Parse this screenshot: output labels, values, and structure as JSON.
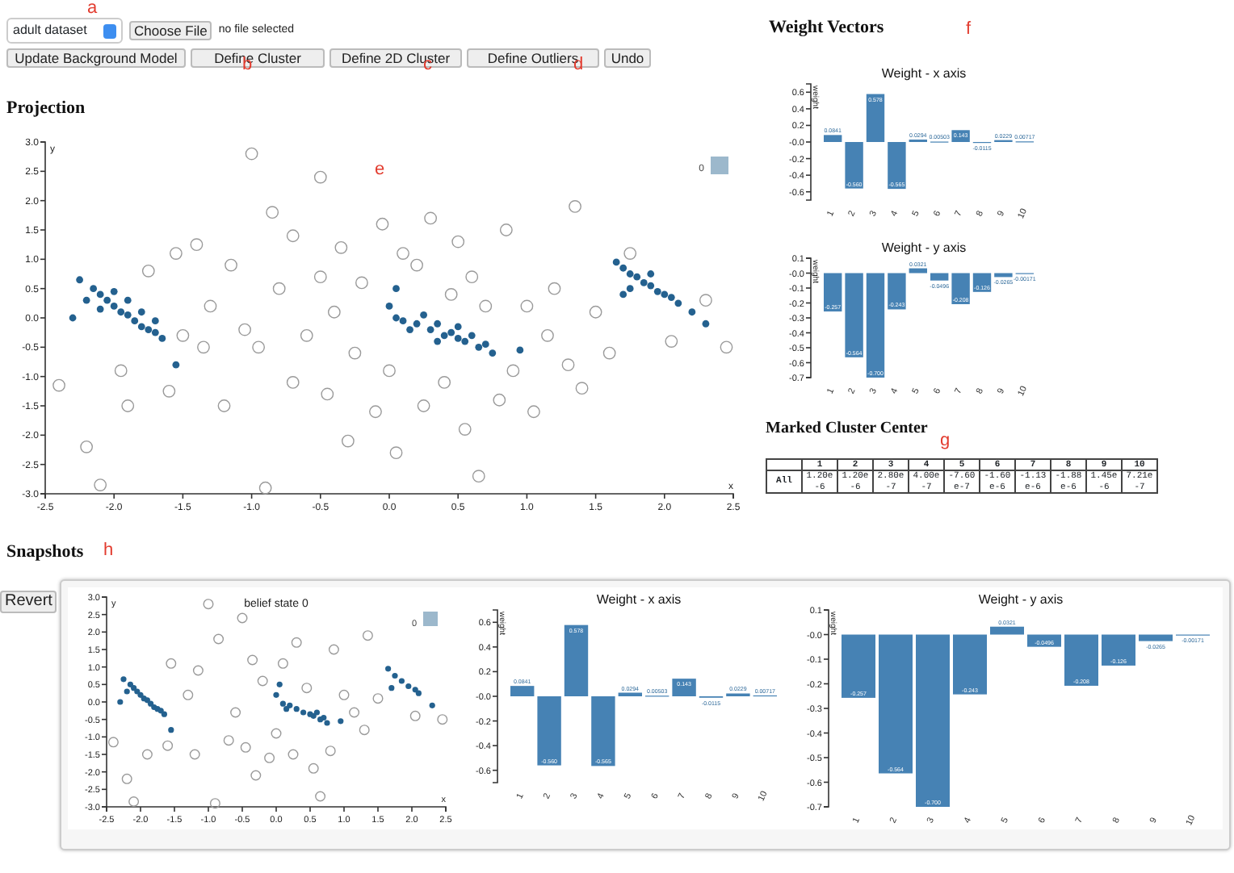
{
  "annotations": [
    "a",
    "b",
    "c",
    "d",
    "e",
    "f",
    "g",
    "h"
  ],
  "toolbar": {
    "dataset_select": "adult dataset",
    "file_button": "Choose File",
    "file_status": "no file selected",
    "buttons": [
      "Update Background Model",
      "Define Cluster",
      "Define 2D Cluster",
      "Define Outliers",
      "Undo"
    ]
  },
  "projection": {
    "title": "Projection",
    "chart_data": {
      "type": "scatter",
      "xlabel": "x",
      "ylabel": "y",
      "xlim": [
        -2.5,
        2.5
      ],
      "ylim": [
        -3,
        3
      ],
      "xticks": [
        {
          "value": -2.5,
          "label": "-2.5"
        },
        {
          "value": -2,
          "label": "-2.0"
        },
        {
          "value": -1.5,
          "label": "-1.5"
        },
        {
          "value": -1,
          "label": "-1.0"
        },
        {
          "value": -0.5,
          "label": "-0.5"
        },
        {
          "value": 0,
          "label": "0.0"
        },
        {
          "value": 0.5,
          "label": "0.5"
        },
        {
          "value": 1,
          "label": "1.0"
        },
        {
          "value": 1.5,
          "label": "1.5"
        },
        {
          "value": 2,
          "label": "2.0"
        },
        {
          "value": 2.5,
          "label": "2.5"
        }
      ],
      "yticks": [
        {
          "value": -3,
          "label": "-3.0"
        },
        {
          "value": -2.5,
          "label": "-2.5"
        },
        {
          "value": -2,
          "label": "-2.0"
        },
        {
          "value": -1.5,
          "label": "-1.5"
        },
        {
          "value": -1,
          "label": "-1.0"
        },
        {
          "value": -0.5,
          "label": "-0.5"
        },
        {
          "value": 0,
          "label": "0.0"
        },
        {
          "value": 0.5,
          "label": "0.5"
        },
        {
          "value": 1,
          "label": "1.0"
        },
        {
          "value": 1.5,
          "label": "1.5"
        },
        {
          "value": 2,
          "label": "2.0"
        },
        {
          "value": 2.5,
          "label": "2.5"
        },
        {
          "value": 3,
          "label": "3.0"
        }
      ],
      "series": [
        {
          "name": "0",
          "color": "#24618f",
          "x": [
            -2.25,
            -2.15,
            -2.1,
            -2.05,
            -2,
            -1.95,
            -1.9,
            -1.85,
            -1.8,
            -1.75,
            -1.7,
            -1.65,
            -2.2,
            -2,
            -1.9,
            -1.8,
            -1.7,
            -1.55,
            -2.3,
            -2.1,
            0,
            0.05,
            0.1,
            0.2,
            0.3,
            0.35,
            0.4,
            0.45,
            0.5,
            0.55,
            0.6,
            0.65,
            0.7,
            0.25,
            0.15,
            0.5,
            0.75,
            0.95,
            0.05,
            0.35,
            1.65,
            1.7,
            1.75,
            1.8,
            1.85,
            1.9,
            1.95,
            2,
            2.05,
            2.1,
            1.75,
            1.9,
            2.2,
            2.3,
            1.7
          ],
          "values": [
            0.65,
            0.5,
            0.4,
            0.3,
            0.2,
            0.1,
            0.05,
            -0.05,
            -0.15,
            -0.2,
            -0.25,
            -0.35,
            0.3,
            0.45,
            0.3,
            0.1,
            -0.05,
            -0.8,
            0,
            0.15,
            0.2,
            0,
            -0.05,
            -0.1,
            -0.2,
            -0.1,
            -0.3,
            -0.25,
            -0.35,
            -0.4,
            -0.3,
            -0.5,
            -0.45,
            0.05,
            -0.2,
            -0.15,
            -0.6,
            -0.55,
            0.5,
            -0.4,
            0.95,
            0.85,
            0.75,
            0.7,
            0.6,
            0.55,
            0.45,
            0.4,
            0.35,
            0.25,
            0.5,
            0.75,
            0.1,
            -0.1,
            0.4
          ]
        },
        {
          "color": "#9a9a9a",
          "x": [
            -2.4,
            -2.2,
            -2.1,
            -1.9,
            -1.95,
            -1.6,
            -1.75,
            -1.55,
            -1.4,
            -1.3,
            -1.35,
            -1.2,
            -1.15,
            -1.05,
            -1,
            -0.9,
            -0.95,
            -0.85,
            -0.8,
            -0.7,
            -0.7,
            -0.6,
            -0.5,
            -0.5,
            -0.45,
            -0.4,
            -0.35,
            -0.3,
            -0.25,
            -0.2,
            -0.1,
            -0.05,
            0,
            0.05,
            0.1,
            0.2,
            0.25,
            0.3,
            0.4,
            0.45,
            0.5,
            0.55,
            0.6,
            0.65,
            0.7,
            0.8,
            0.85,
            0.9,
            1,
            1.05,
            1.15,
            1.2,
            1.3,
            1.35,
            1.4,
            1.5,
            1.6,
            1.75,
            2.05,
            2.3,
            2.45,
            -1.5
          ],
          "values": [
            -1.15,
            -2.2,
            -2.85,
            -1.5,
            -0.9,
            -1.25,
            0.8,
            1.1,
            1.25,
            0.2,
            -0.5,
            -1.5,
            0.9,
            -0.2,
            2.8,
            -2.9,
            -0.5,
            1.8,
            0.5,
            -1.1,
            1.4,
            -0.3,
            2.4,
            0.7,
            -1.3,
            0.1,
            1.2,
            -2.1,
            -0.6,
            0.6,
            -1.6,
            1.6,
            -0.9,
            -2.3,
            1.1,
            0.9,
            -1.5,
            1.7,
            -1.1,
            0.4,
            1.3,
            -1.9,
            0.7,
            -2.7,
            0.2,
            -1.4,
            1.5,
            -0.9,
            0.2,
            -1.6,
            -0.3,
            0.5,
            -0.8,
            1.9,
            -1.2,
            0.1,
            -0.6,
            1.1,
            -0.4,
            0.3,
            -0.5,
            -0.3
          ]
        }
      ]
    }
  },
  "weight_vectors": {
    "title": "Weight Vectors",
    "charts": [
      {
        "chart_data": {
          "type": "bar",
          "title": "Weight - x axis",
          "ylabel": "weight",
          "categories": [
            "1",
            "2",
            "3",
            "4",
            "5",
            "6",
            "7",
            "8",
            "9",
            "10"
          ],
          "values": [
            0.0841,
            -0.56,
            0.578,
            -0.565,
            0.0294,
            0.00503,
            0.143,
            -0.0115,
            0.0229,
            0.00717
          ],
          "ylim": [
            -0.7,
            0.7
          ],
          "yticks": [
            {
              "value": -0.6,
              "label": "-0.6"
            },
            {
              "value": -0.4,
              "label": "-0.4"
            },
            {
              "value": -0.2,
              "label": "-0.2"
            },
            {
              "value": 0,
              "label": "-0.0"
            },
            {
              "value": 0.2,
              "label": "0.2"
            },
            {
              "value": 0.4,
              "label": "0.4"
            },
            {
              "value": 0.6,
              "label": "0.6"
            }
          ],
          "value_labels": [
            "0.0841",
            "-0.560",
            "0.578",
            "-0.565",
            "0.0294",
            "0.00503",
            "0.143",
            "-0.0115",
            "0.0229",
            "0.00717"
          ]
        }
      },
      {
        "chart_data": {
          "type": "bar",
          "title": "Weight - y axis",
          "ylabel": "weight",
          "categories": [
            "1",
            "2",
            "3",
            "4",
            "5",
            "6",
            "7",
            "8",
            "9",
            "10"
          ],
          "values": [
            -0.257,
            -0.564,
            -0.7,
            -0.243,
            0.0321,
            -0.0496,
            -0.208,
            -0.126,
            -0.0265,
            -0.00171
          ],
          "ylim": [
            -0.7,
            0.1
          ],
          "yticks": [
            {
              "value": -0.7,
              "label": "-0.7"
            },
            {
              "value": -0.6,
              "label": "-0.6"
            },
            {
              "value": -0.5,
              "label": "-0.5"
            },
            {
              "value": -0.4,
              "label": "-0.4"
            },
            {
              "value": -0.3,
              "label": "-0.3"
            },
            {
              "value": -0.2,
              "label": "-0.2"
            },
            {
              "value": -0.1,
              "label": "-0.1"
            },
            {
              "value": 0,
              "label": "-0.0"
            },
            {
              "value": 0.1,
              "label": "0.1"
            }
          ],
          "value_labels": [
            "-0.257",
            "-0.564",
            "-0.700",
            "-0.243",
            "0.0321",
            "-0.0496",
            "-0.208",
            "-0.126",
            "-0.0265",
            "-0.00171"
          ]
        }
      }
    ]
  },
  "marked_cluster": {
    "title": "Marked Cluster Center",
    "columns": [
      "1",
      "2",
      "3",
      "4",
      "5",
      "6",
      "7",
      "8",
      "9",
      "10"
    ],
    "rows": [
      {
        "label": "All",
        "cells": [
          "1.20e-6",
          "1.20e-6",
          "2.80e-7",
          "4.00e-7",
          "-7.60e-7",
          "-1.60e-6",
          "-1.13e-6",
          "-1.88e-6",
          "1.45e-6",
          "7.21e-7"
        ]
      }
    ]
  },
  "snapshots": {
    "title": "Snapshots",
    "revert_button": "Revert",
    "items": [
      {
        "projection": {
          "chart_data": {
            "type": "scatter",
            "title": "belief state 0",
            "xlabel": "x",
            "ylabel": "y",
            "xlim": [
              -2.5,
              2.5
            ],
            "ylim": [
              -3,
              3
            ],
            "xticks": [
              {
                "value": -2.5,
                "label": "-2.5"
              },
              {
                "value": -2,
                "label": "-2.0"
              },
              {
                "value": -1.5,
                "label": "-1.5"
              },
              {
                "value": -1,
                "label": "-1.0"
              },
              {
                "value": -0.5,
                "label": "-0.5"
              },
              {
                "value": 0,
                "label": "0.0"
              },
              {
                "value": 0.5,
                "label": "0.5"
              },
              {
                "value": 1,
                "label": "1.0"
              },
              {
                "value": 1.5,
                "label": "1.5"
              },
              {
                "value": 2,
                "label": "2.0"
              },
              {
                "value": 2.5,
                "label": "2.5"
              }
            ],
            "yticks": [
              {
                "value": -3,
                "label": "-3.0"
              },
              {
                "value": -2.5,
                "label": "-2.5"
              },
              {
                "value": -2,
                "label": "-2.0"
              },
              {
                "value": -1.5,
                "label": "-1.5"
              },
              {
                "value": -1,
                "label": "-1.0"
              },
              {
                "value": -0.5,
                "label": "-0.5"
              },
              {
                "value": 0,
                "label": "0.0"
              },
              {
                "value": 0.5,
                "label": "0.5"
              },
              {
                "value": 1,
                "label": "1.0"
              },
              {
                "value": 1.5,
                "label": "1.5"
              },
              {
                "value": 2,
                "label": "2.0"
              },
              {
                "value": 2.5,
                "label": "2.5"
              },
              {
                "value": 3,
                "label": "3.0"
              }
            ],
            "series": [
              {
                "name": "0",
                "color": "#24618f",
                "x": [
                  -2.25,
                  -2.15,
                  -2.1,
                  -2.05,
                  -2,
                  -1.95,
                  -1.9,
                  -1.85,
                  -1.8,
                  -1.75,
                  -1.7,
                  -1.65,
                  -2.2,
                  -1.55,
                  -2.3,
                  0,
                  0.1,
                  0.2,
                  0.3,
                  0.4,
                  0.5,
                  0.55,
                  0.6,
                  0.65,
                  0.7,
                  0.15,
                  0.75,
                  0.95,
                  0.05,
                  1.65,
                  1.75,
                  1.85,
                  1.95,
                  2.05,
                  2.1,
                  1.7,
                  2.3
                ],
                "values": [
                  0.65,
                  0.5,
                  0.4,
                  0.3,
                  0.2,
                  0.1,
                  0.05,
                  -0.05,
                  -0.15,
                  -0.2,
                  -0.25,
                  -0.35,
                  0.3,
                  -0.8,
                  0,
                  0.2,
                  -0.05,
                  -0.1,
                  -0.2,
                  -0.3,
                  -0.35,
                  -0.4,
                  -0.3,
                  -0.5,
                  -0.45,
                  -0.2,
                  -0.6,
                  -0.55,
                  0.5,
                  0.95,
                  0.75,
                  0.6,
                  0.45,
                  0.35,
                  0.25,
                  0.4,
                  -0.1
                ]
              },
              {
                "color": "#9a9a9a",
                "x": [
                  -2.4,
                  -2.2,
                  -2.1,
                  -1.9,
                  -1.6,
                  -1.55,
                  -1.3,
                  -1.2,
                  -1.15,
                  -1,
                  -0.9,
                  -0.85,
                  -0.7,
                  -0.6,
                  -0.5,
                  -0.45,
                  -0.35,
                  -0.3,
                  -0.2,
                  -0.1,
                  0,
                  0.1,
                  0.25,
                  0.3,
                  0.45,
                  0.55,
                  0.65,
                  0.8,
                  0.85,
                  1,
                  1.15,
                  1.3,
                  1.35,
                  1.5,
                  2.05,
                  2.45
                ],
                "values": [
                  -1.15,
                  -2.2,
                  -2.85,
                  -1.5,
                  -1.25,
                  1.1,
                  0.2,
                  -1.5,
                  0.9,
                  2.8,
                  -2.9,
                  1.8,
                  -1.1,
                  -0.3,
                  2.4,
                  -1.3,
                  1.2,
                  -2.1,
                  0.6,
                  -1.6,
                  -0.9,
                  1.1,
                  -1.5,
                  1.7,
                  0.4,
                  -1.9,
                  -2.7,
                  -1.4,
                  1.5,
                  0.2,
                  -0.3,
                  -0.8,
                  1.9,
                  0.1,
                  -0.4,
                  -0.5
                ]
              }
            ]
          }
        },
        "charts": [
          {
            "chart_data": {
              "type": "bar",
              "title": "Weight - x axis",
              "ylabel": "weight",
              "categories": [
                "1",
                "2",
                "3",
                "4",
                "5",
                "6",
                "7",
                "8",
                "9",
                "10"
              ],
              "values": [
                0.0841,
                -0.56,
                0.578,
                -0.565,
                0.0294,
                0.00503,
                0.143,
                -0.0115,
                0.0229,
                0.00717
              ],
              "ylim": [
                -0.7,
                0.7
              ],
              "yticks": [
                {
                  "value": -0.6,
                  "label": "-0.6"
                },
                {
                  "value": -0.4,
                  "label": "-0.4"
                },
                {
                  "value": -0.2,
                  "label": "-0.2"
                },
                {
                  "value": 0,
                  "label": "-0.0"
                },
                {
                  "value": 0.2,
                  "label": "0.2"
                },
                {
                  "value": 0.4,
                  "label": "0.4"
                },
                {
                  "value": 0.6,
                  "label": "0.6"
                }
              ],
              "value_labels": [
                "0.0841",
                "-0.560",
                "0.578",
                "-0.565",
                "0.0294",
                "0.00503",
                "0.143",
                "-0.0115",
                "0.0229",
                "0.00717"
              ]
            }
          },
          {
            "chart_data": {
              "type": "bar",
              "title": "Weight - y axis",
              "ylabel": "weight",
              "categories": [
                "1",
                "2",
                "3",
                "4",
                "5",
                "6",
                "7",
                "8",
                "9",
                "10"
              ],
              "values": [
                -0.257,
                -0.564,
                -0.7,
                -0.243,
                0.0321,
                -0.0496,
                -0.208,
                -0.126,
                -0.0265,
                -0.00171
              ],
              "ylim": [
                -0.7,
                0.1
              ],
              "yticks": [
                {
                  "value": -0.7,
                  "label": "-0.7"
                },
                {
                  "value": -0.6,
                  "label": "-0.6"
                },
                {
                  "value": -0.5,
                  "label": "-0.5"
                },
                {
                  "value": -0.4,
                  "label": "-0.4"
                },
                {
                  "value": -0.3,
                  "label": "-0.3"
                },
                {
                  "value": -0.2,
                  "label": "-0.2"
                },
                {
                  "value": -0.1,
                  "label": "-0.1"
                },
                {
                  "value": 0,
                  "label": "-0.0"
                },
                {
                  "value": 0.1,
                  "label": "0.1"
                }
              ],
              "value_labels": [
                "-0.257",
                "-0.564",
                "-0.700",
                "-0.243",
                "0.0321",
                "-0.0496",
                "-0.208",
                "-0.126",
                "-0.0265",
                "-0.00171"
              ]
            }
          }
        ]
      }
    ]
  }
}
